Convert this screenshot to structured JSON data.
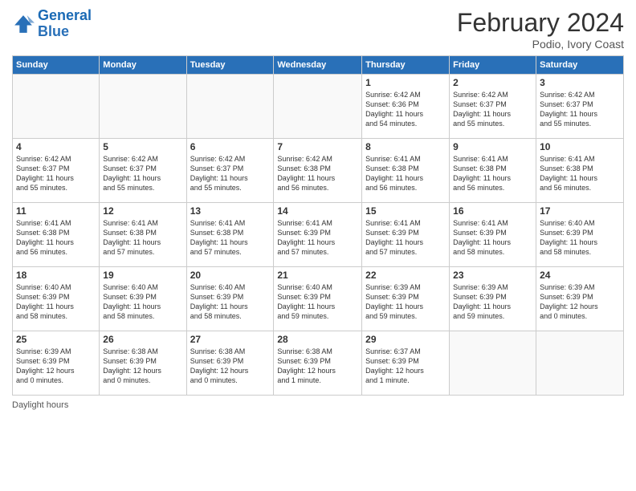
{
  "logo": {
    "line1": "General",
    "line2": "Blue"
  },
  "title": "February 2024",
  "subtitle": "Podio, Ivory Coast",
  "days_of_week": [
    "Sunday",
    "Monday",
    "Tuesday",
    "Wednesday",
    "Thursday",
    "Friday",
    "Saturday"
  ],
  "footer": {
    "label": "Daylight hours"
  },
  "weeks": [
    [
      {
        "num": "",
        "info": ""
      },
      {
        "num": "",
        "info": ""
      },
      {
        "num": "",
        "info": ""
      },
      {
        "num": "",
        "info": ""
      },
      {
        "num": "1",
        "info": "Sunrise: 6:42 AM\nSunset: 6:36 PM\nDaylight: 11 hours\nand 54 minutes."
      },
      {
        "num": "2",
        "info": "Sunrise: 6:42 AM\nSunset: 6:37 PM\nDaylight: 11 hours\nand 55 minutes."
      },
      {
        "num": "3",
        "info": "Sunrise: 6:42 AM\nSunset: 6:37 PM\nDaylight: 11 hours\nand 55 minutes."
      }
    ],
    [
      {
        "num": "4",
        "info": "Sunrise: 6:42 AM\nSunset: 6:37 PM\nDaylight: 11 hours\nand 55 minutes."
      },
      {
        "num": "5",
        "info": "Sunrise: 6:42 AM\nSunset: 6:37 PM\nDaylight: 11 hours\nand 55 minutes."
      },
      {
        "num": "6",
        "info": "Sunrise: 6:42 AM\nSunset: 6:37 PM\nDaylight: 11 hours\nand 55 minutes."
      },
      {
        "num": "7",
        "info": "Sunrise: 6:42 AM\nSunset: 6:38 PM\nDaylight: 11 hours\nand 56 minutes."
      },
      {
        "num": "8",
        "info": "Sunrise: 6:41 AM\nSunset: 6:38 PM\nDaylight: 11 hours\nand 56 minutes."
      },
      {
        "num": "9",
        "info": "Sunrise: 6:41 AM\nSunset: 6:38 PM\nDaylight: 11 hours\nand 56 minutes."
      },
      {
        "num": "10",
        "info": "Sunrise: 6:41 AM\nSunset: 6:38 PM\nDaylight: 11 hours\nand 56 minutes."
      }
    ],
    [
      {
        "num": "11",
        "info": "Sunrise: 6:41 AM\nSunset: 6:38 PM\nDaylight: 11 hours\nand 56 minutes."
      },
      {
        "num": "12",
        "info": "Sunrise: 6:41 AM\nSunset: 6:38 PM\nDaylight: 11 hours\nand 57 minutes."
      },
      {
        "num": "13",
        "info": "Sunrise: 6:41 AM\nSunset: 6:38 PM\nDaylight: 11 hours\nand 57 minutes."
      },
      {
        "num": "14",
        "info": "Sunrise: 6:41 AM\nSunset: 6:39 PM\nDaylight: 11 hours\nand 57 minutes."
      },
      {
        "num": "15",
        "info": "Sunrise: 6:41 AM\nSunset: 6:39 PM\nDaylight: 11 hours\nand 57 minutes."
      },
      {
        "num": "16",
        "info": "Sunrise: 6:41 AM\nSunset: 6:39 PM\nDaylight: 11 hours\nand 58 minutes."
      },
      {
        "num": "17",
        "info": "Sunrise: 6:40 AM\nSunset: 6:39 PM\nDaylight: 11 hours\nand 58 minutes."
      }
    ],
    [
      {
        "num": "18",
        "info": "Sunrise: 6:40 AM\nSunset: 6:39 PM\nDaylight: 11 hours\nand 58 minutes."
      },
      {
        "num": "19",
        "info": "Sunrise: 6:40 AM\nSunset: 6:39 PM\nDaylight: 11 hours\nand 58 minutes."
      },
      {
        "num": "20",
        "info": "Sunrise: 6:40 AM\nSunset: 6:39 PM\nDaylight: 11 hours\nand 58 minutes."
      },
      {
        "num": "21",
        "info": "Sunrise: 6:40 AM\nSunset: 6:39 PM\nDaylight: 11 hours\nand 59 minutes."
      },
      {
        "num": "22",
        "info": "Sunrise: 6:39 AM\nSunset: 6:39 PM\nDaylight: 11 hours\nand 59 minutes."
      },
      {
        "num": "23",
        "info": "Sunrise: 6:39 AM\nSunset: 6:39 PM\nDaylight: 11 hours\nand 59 minutes."
      },
      {
        "num": "24",
        "info": "Sunrise: 6:39 AM\nSunset: 6:39 PM\nDaylight: 12 hours\nand 0 minutes."
      }
    ],
    [
      {
        "num": "25",
        "info": "Sunrise: 6:39 AM\nSunset: 6:39 PM\nDaylight: 12 hours\nand 0 minutes."
      },
      {
        "num": "26",
        "info": "Sunrise: 6:38 AM\nSunset: 6:39 PM\nDaylight: 12 hours\nand 0 minutes."
      },
      {
        "num": "27",
        "info": "Sunrise: 6:38 AM\nSunset: 6:39 PM\nDaylight: 12 hours\nand 0 minutes."
      },
      {
        "num": "28",
        "info": "Sunrise: 6:38 AM\nSunset: 6:39 PM\nDaylight: 12 hours\nand 1 minute."
      },
      {
        "num": "29",
        "info": "Sunrise: 6:37 AM\nSunset: 6:39 PM\nDaylight: 12 hours\nand 1 minute."
      },
      {
        "num": "",
        "info": ""
      },
      {
        "num": "",
        "info": ""
      }
    ]
  ]
}
